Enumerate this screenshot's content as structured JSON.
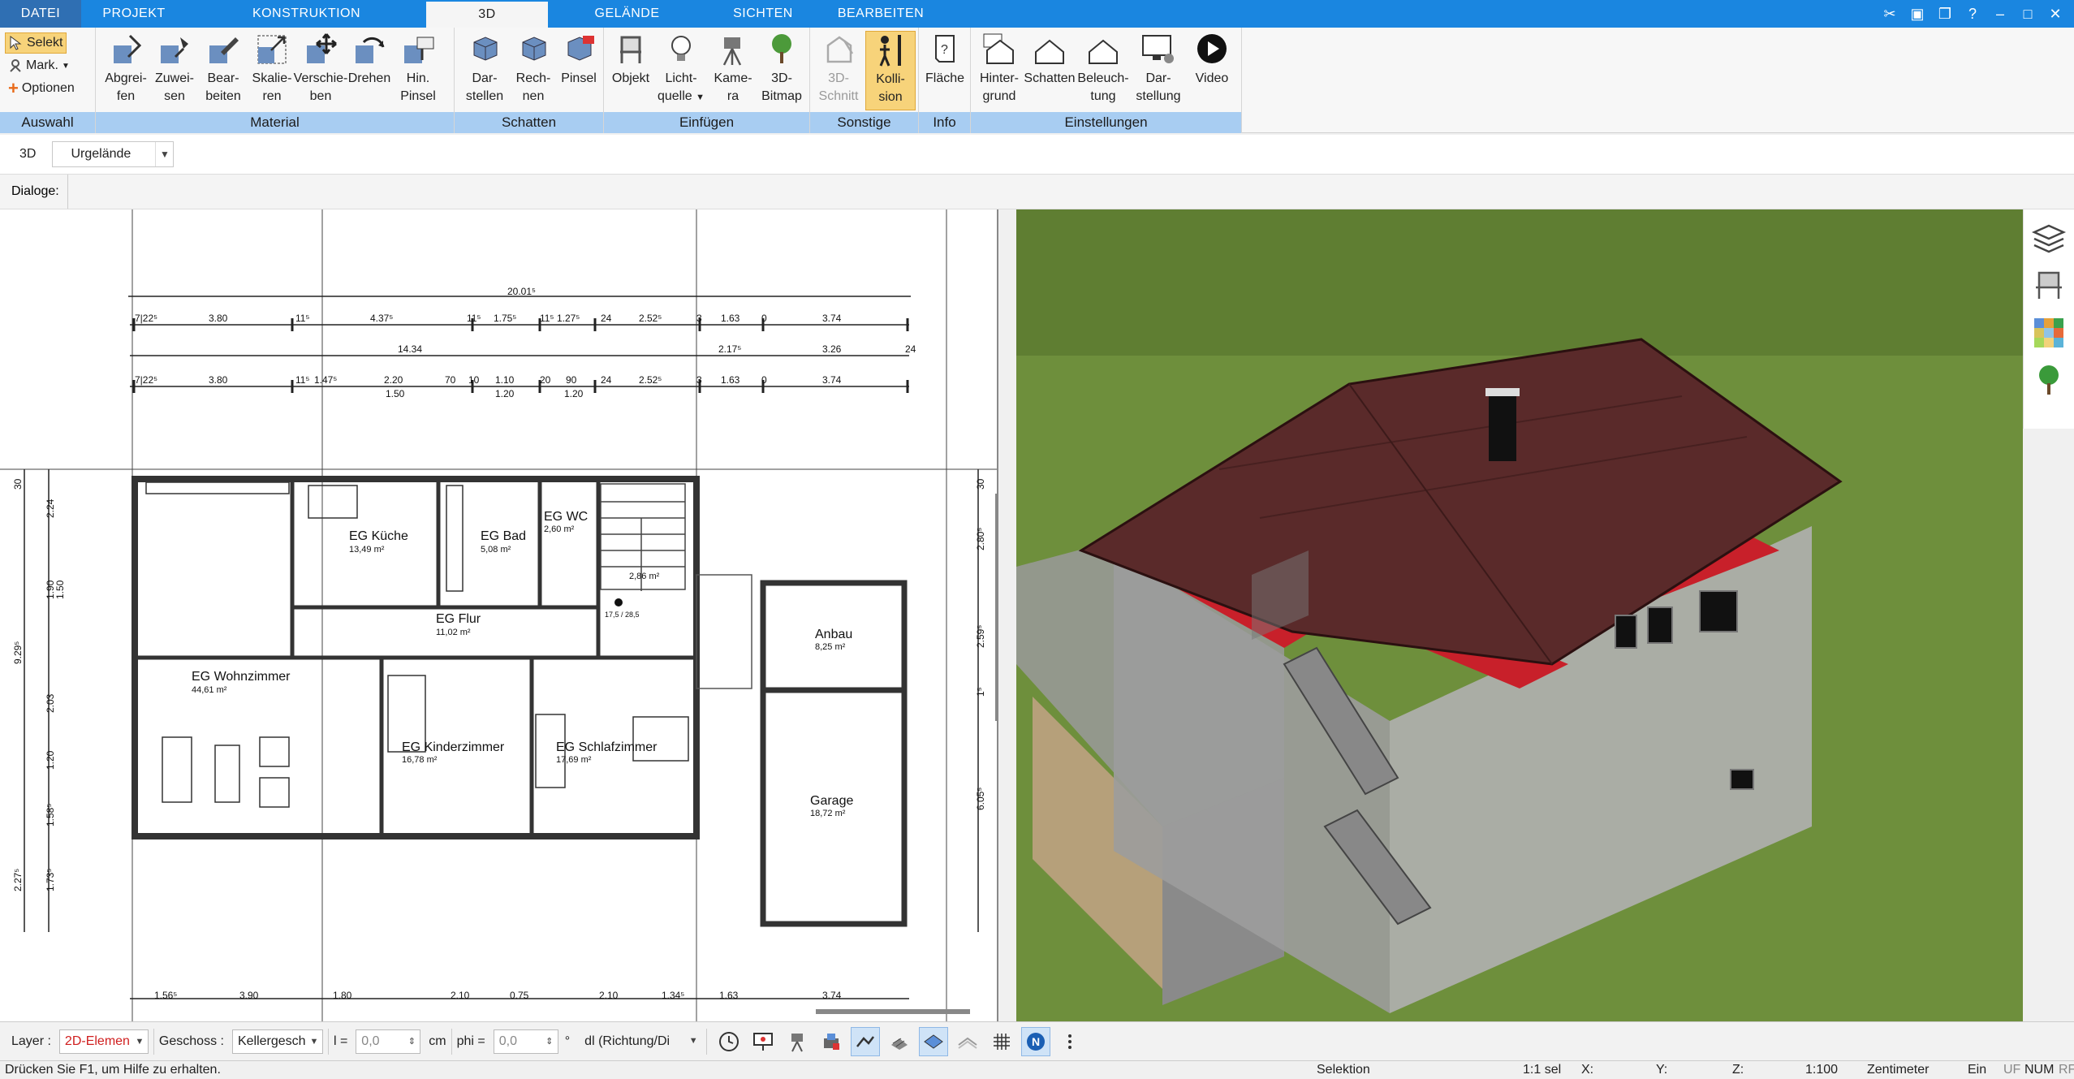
{
  "menu": {
    "tabs": [
      {
        "label": "DATEI"
      },
      {
        "label": "PROJEKT"
      },
      {
        "label": "KONSTRUKTION"
      },
      {
        "label": "3D"
      },
      {
        "label": "GELÄNDE"
      },
      {
        "label": "SICHTEN"
      },
      {
        "label": "BEARBEITEN"
      }
    ],
    "active": "3D"
  },
  "ribbon": {
    "auswahl": {
      "label": "Auswahl",
      "selekt": "Selekt",
      "mark": "Mark.",
      "optionen": "Optionen"
    },
    "material": {
      "label": "Material",
      "buttons": [
        {
          "l1": "Abgrei-",
          "l2": "fen"
        },
        {
          "l1": "Zuwei-",
          "l2": "sen"
        },
        {
          "l1": "Bear-",
          "l2": "beiten"
        },
        {
          "l1": "Skalie-",
          "l2": "ren"
        },
        {
          "l1": "Verschie-",
          "l2": "ben"
        },
        {
          "l1": "Drehen",
          "l2": ""
        },
        {
          "l1": "Hin.",
          "l2": "Pinsel"
        }
      ]
    },
    "schatten": {
      "label": "Schatten",
      "buttons": [
        {
          "l1": "Dar-",
          "l2": "stellen"
        },
        {
          "l1": "Rech-",
          "l2": "nen"
        },
        {
          "l1": "Pinsel",
          "l2": ""
        }
      ]
    },
    "einfuegen": {
      "label": "Einfügen",
      "buttons": [
        {
          "l1": "Objekt",
          "l2": ""
        },
        {
          "l1": "Licht-",
          "l2": "quelle"
        },
        {
          "l1": "Kame-",
          "l2": "ra"
        },
        {
          "l1": "3D-",
          "l2": "Bitmap"
        }
      ]
    },
    "sonstige": {
      "label": "Sonstige",
      "buttons": [
        {
          "l1": "3D-",
          "l2": "Schnitt"
        },
        {
          "l1": "Kolli-",
          "l2": "sion"
        }
      ]
    },
    "info": {
      "label": "Info",
      "buttons": [
        {
          "l1": "Fläche",
          "l2": ""
        }
      ]
    },
    "einstellungen": {
      "label": "Einstellungen",
      "buttons": [
        {
          "l1": "Hinter-",
          "l2": "grund"
        },
        {
          "l1": "Schatten",
          "l2": ""
        },
        {
          "l1": "Beleuch-",
          "l2": "tung"
        },
        {
          "l1": "Dar-",
          "l2": "stellung"
        },
        {
          "l1": "Video",
          "l2": ""
        }
      ]
    }
  },
  "subbar": {
    "mode_label": "3D",
    "terrain_value": "Urgelände"
  },
  "dialoge_label": "Dialoge:",
  "plan": {
    "dimensions": {
      "total": "20.01⁵",
      "row1": [
        "7|22⁵",
        "3.80",
        "11⁵",
        "4.37⁵",
        "11⁵",
        "1.75⁵",
        "11⁵",
        "1.27⁵",
        "24",
        "2.52⁵",
        "3",
        "1.63",
        "0",
        "3.74"
      ],
      "row2": [
        "14.34",
        "2.17⁵",
        "3.26",
        "24"
      ],
      "row3": [
        "7|22⁵",
        "3.80",
        "11⁵",
        "1.47⁵",
        "2.20",
        "1.50",
        "70",
        "10",
        "1.10",
        "1.20",
        "20",
        "90",
        "1.20",
        "24",
        "2.52⁵",
        "3",
        "1.63",
        "0",
        "3.74"
      ],
      "left": [
        "2.24",
        "1.90",
        "1.50",
        "9.29⁵",
        "2.03",
        "1.20",
        "1.58⁵",
        "2.27⁵",
        "1.73⁵",
        "30"
      ],
      "right": [
        "30",
        "2.80⁵",
        "2.59⁵",
        "1⁵",
        "6.05⁵"
      ],
      "bottom": [
        "1.56⁵",
        "3.90",
        "1.80",
        "2.10",
        "0.75",
        "2.10",
        "1.34⁵",
        "1.63",
        "3.74"
      ],
      "stair": "17,5 / 28,5"
    },
    "rooms": [
      {
        "name": "EG Küche",
        "area": "13,49 m²"
      },
      {
        "name": "EG Bad",
        "area": "5,08 m²"
      },
      {
        "name": "EG WC",
        "area": "2,60 m²"
      },
      {
        "name": "",
        "area": "2,86 m²"
      },
      {
        "name": "EG Flur",
        "area": "11,02 m²"
      },
      {
        "name": "EG Wohnzimmer",
        "area": "44,61 m²"
      },
      {
        "name": "EG Kinderzimmer",
        "area": "16,78 m²"
      },
      {
        "name": "EG Schlafzimmer",
        "area": "17,69 m²"
      },
      {
        "name": "Anbau",
        "area": "8,25 m²"
      },
      {
        "name": "Garage",
        "area": "18,72 m²"
      }
    ]
  },
  "bottom": {
    "layer_label": "Layer :",
    "layer_value": "2D-Elemen",
    "geschoss_label": "Geschoss :",
    "geschoss_value": "Kellergesch",
    "l_label": "l =",
    "l_value": "0,0",
    "l_unit": "cm",
    "phi_label": "phi =",
    "phi_value": "0,0",
    "phi_unit": "°",
    "dir_value": "dl (Richtung/Di"
  },
  "status": {
    "help": "Drücken Sie F1, um Hilfe zu erhalten.",
    "mode": "Selektion",
    "sel": "1:1 sel",
    "x": "X:",
    "y": "Y:",
    "z": "Z:",
    "scale": "1:100",
    "unit": "Zentimeter",
    "ein": "Ein",
    "uf": "UF",
    "num": "NUM",
    "rf": "RF"
  },
  "colors": {
    "menubar": "#1a86e0",
    "group_label": "#a8cdf2",
    "active_button": "#f7d37a",
    "grass": "#6e8f3c",
    "roof": "#5a2a2a",
    "walls": "#9a9a9a",
    "interior_red": "#c8202a"
  }
}
